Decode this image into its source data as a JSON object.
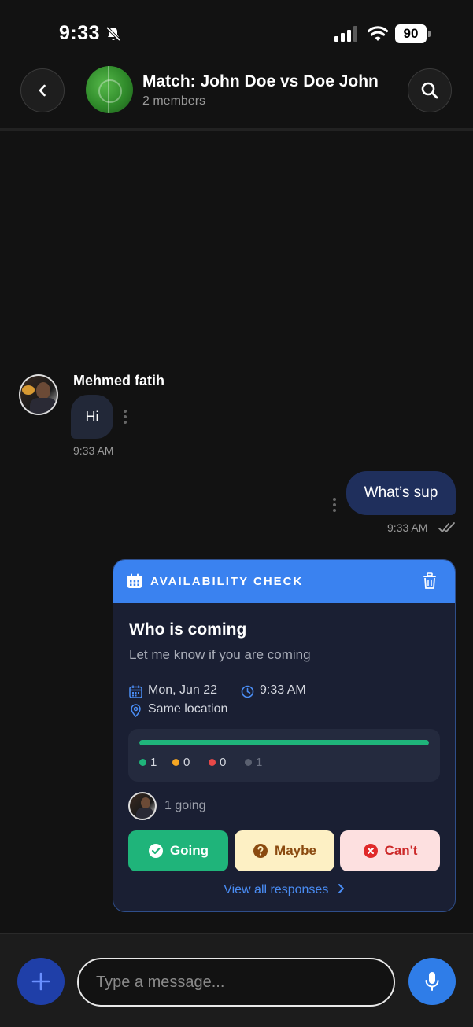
{
  "status_bar": {
    "time": "9:33",
    "battery": "90"
  },
  "header": {
    "title": "Match: John Doe vs Doe John",
    "subtitle": "2 members"
  },
  "messages": {
    "incoming": {
      "sender": "Mehmed fatih",
      "text": "Hi",
      "time": "9:33 AM"
    },
    "outgoing": {
      "text": "What’s sup",
      "time": "9:33 AM"
    }
  },
  "availability_card": {
    "header_label": "AVAILABILITY CHECK",
    "title": "Who is coming",
    "description": "Let me know if you are coming",
    "date": "Mon, Jun 22",
    "time": "9:33 AM",
    "location": "Same location",
    "going_fraction": 1.0,
    "tally": {
      "going": "1",
      "maybe": "0",
      "cant": "0",
      "no_response": "1"
    },
    "going_text": "1 going",
    "buttons": {
      "going": "Going",
      "maybe": "Maybe",
      "cant": "Can't"
    },
    "view_all": "View all responses",
    "colors": {
      "header": "#3a82f0",
      "going": "#1fb47a",
      "maybe": "#f5a623",
      "cant": "#e84848",
      "no_response": "#5a6070"
    }
  },
  "composer": {
    "placeholder": "Type a message..."
  }
}
